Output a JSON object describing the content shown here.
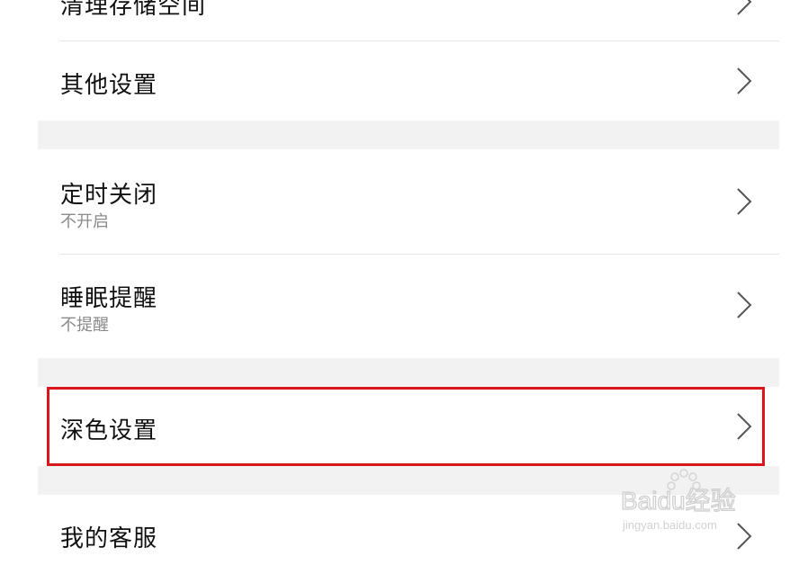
{
  "settings": {
    "rows": [
      {
        "label": "清理存储空间",
        "sub": ""
      },
      {
        "label": "其他设置",
        "sub": ""
      },
      {
        "label": "定时关闭",
        "sub": "不开启"
      },
      {
        "label": "睡眠提醒",
        "sub": "不提醒"
      },
      {
        "label": "深色设置",
        "sub": ""
      },
      {
        "label": "我的客服",
        "sub": ""
      }
    ]
  },
  "watermark": {
    "brand": "Baidu经验",
    "url": "jingyan.baidu.com"
  },
  "colors": {
    "highlight": "#d9161c",
    "divider": "#e6e6e6",
    "section_gap": "#f2f2f2",
    "subtitle": "#8a8a8a"
  }
}
